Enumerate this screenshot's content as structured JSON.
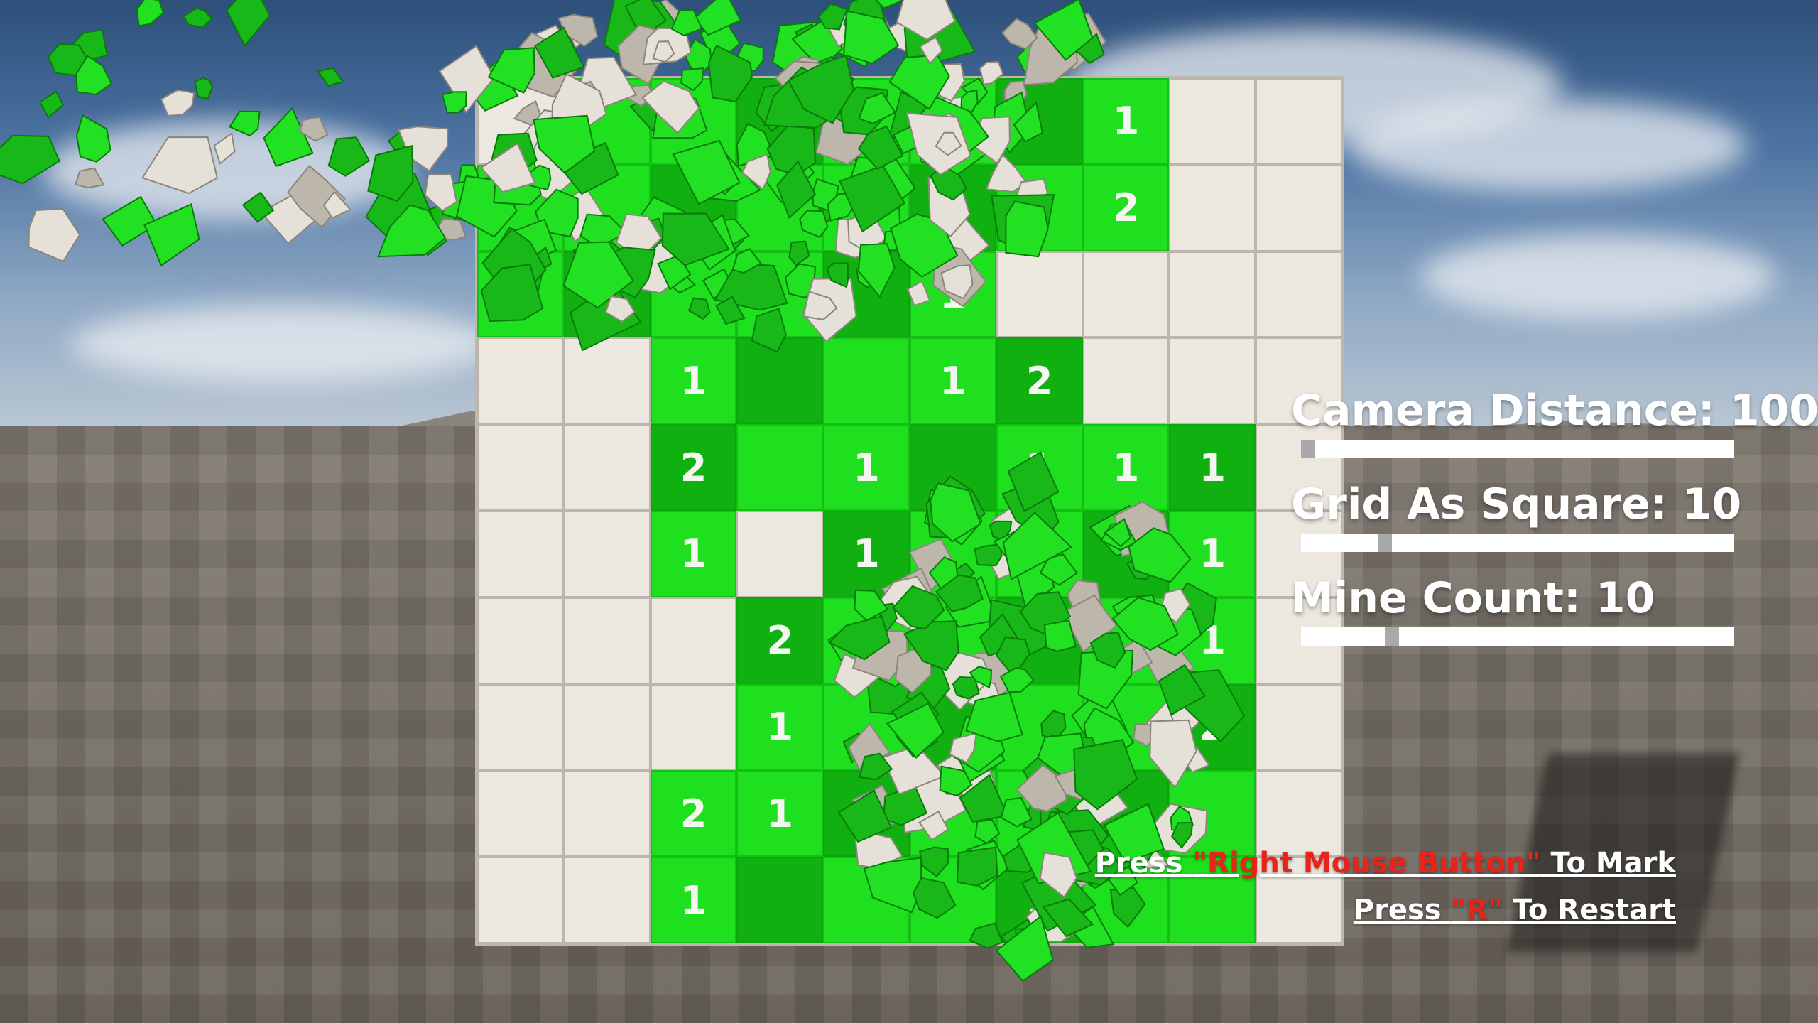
{
  "hud": {
    "camera_distance": {
      "label": "Camera Distance: 100",
      "value": 100
    },
    "grid_size": {
      "label": "Grid As Square: 10",
      "value": 10
    },
    "mine_count": {
      "label": "Mine Count: 10",
      "value": 10
    }
  },
  "hints": {
    "mark": {
      "prefix": "Press ",
      "key": "\"Right Mouse Button\"",
      "suffix": " To Mark"
    },
    "restart": {
      "prefix": "Press ",
      "key": "\"R\"",
      "suffix": " To Restart"
    }
  },
  "colors": {
    "revealed": "#1ee01e",
    "hidden": "#ece7df",
    "key_highlight": "#e8231a"
  },
  "board": {
    "rows": [
      [
        "H",
        "O",
        "O",
        "O",
        "O",
        "O",
        "O",
        "1",
        "H",
        "H"
      ],
      [
        "O",
        "O",
        "O",
        "O",
        "O",
        "1",
        "1",
        "2",
        "H",
        "H"
      ],
      [
        "1",
        "O",
        "O",
        "O",
        "O",
        "1",
        "H",
        "H",
        "H",
        "H"
      ],
      [
        "H",
        "H",
        "1",
        "O",
        "O",
        "1",
        "2",
        "H",
        "H",
        "H"
      ],
      [
        "H",
        "H",
        "2",
        "O",
        "1",
        "O",
        "1",
        "1",
        "1",
        "H"
      ],
      [
        "H",
        "H",
        "1",
        "H",
        "1",
        "O",
        "O",
        "O",
        "1",
        "H"
      ],
      [
        "H",
        "H",
        "H",
        "2",
        "1",
        "O",
        "O",
        "O",
        "1",
        "H"
      ],
      [
        "H",
        "H",
        "H",
        "1",
        "O",
        "O",
        "O",
        "O",
        "2",
        "H"
      ],
      [
        "H",
        "H",
        "2",
        "1",
        "O",
        "O",
        "O",
        "O",
        "O",
        "H"
      ],
      [
        "H",
        "H",
        "1",
        "O",
        "O",
        "O",
        "1",
        "O",
        "O",
        "H"
      ]
    ]
  }
}
